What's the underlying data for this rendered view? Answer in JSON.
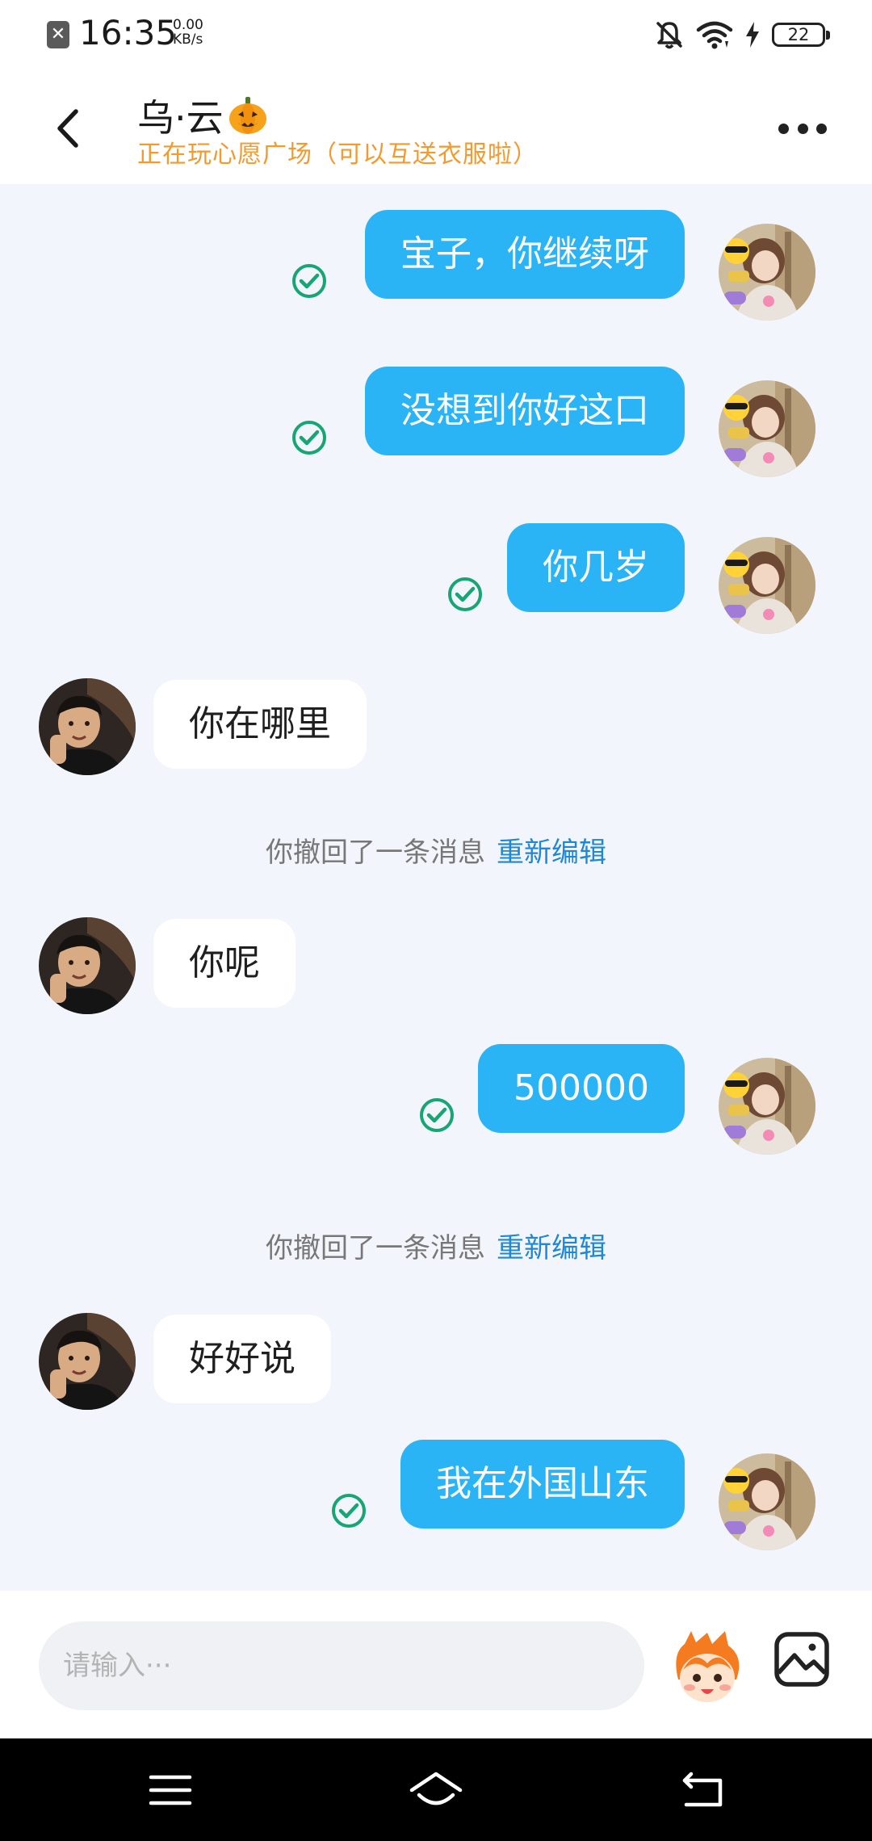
{
  "status_bar": {
    "time": "16:35",
    "net_speed_value": "0.00",
    "net_speed_unit": "KB/s",
    "battery": "22",
    "icons": [
      "notification-blocked-icon",
      "close-notification-icon",
      "wifi-icon",
      "charging-icon",
      "battery-icon"
    ]
  },
  "header": {
    "title": "乌·云",
    "status": "正在玩心愿广场（可以互送衣服啦）",
    "title_emoji_icon": "pumpkin-icon",
    "back_icon": "back-arrow-icon",
    "more_icon": "more-dots-icon"
  },
  "messages": [
    {
      "direction": "out",
      "text": "宝子，你继续呀",
      "status": "sent-check-icon"
    },
    {
      "direction": "out",
      "text": "没想到你好这口",
      "status": "sent-check-icon"
    },
    {
      "direction": "out",
      "text": "你几岁",
      "status": "sent-check-icon"
    },
    {
      "direction": "in",
      "text": "你在哪里"
    },
    {
      "direction": "system",
      "text": "你撤回了一条消息",
      "action": "重新编辑"
    },
    {
      "direction": "in",
      "text": "你呢"
    },
    {
      "direction": "out",
      "text": "500000",
      "status": "sent-check-icon"
    },
    {
      "direction": "system",
      "text": "你撤回了一条消息",
      "action": "重新编辑"
    },
    {
      "direction": "in",
      "text": "好好说"
    },
    {
      "direction": "out",
      "text": "我在外国山东",
      "status": "sent-check-icon"
    }
  ],
  "input": {
    "placeholder": "请输入···",
    "sticker_icon": "sticker-face-icon",
    "photo_icon": "photo-icon"
  },
  "nav_bar": {
    "icons": [
      "menu-icon",
      "home-icon",
      "back-icon"
    ]
  },
  "colors": {
    "outgoing_bubble": "#2ab4f5",
    "incoming_bubble": "#ffffff",
    "status_orange": "#f29a2e",
    "check_green": "#17a673",
    "link_blue": "#1e88d2",
    "chat_background": "#f2f5fb"
  }
}
